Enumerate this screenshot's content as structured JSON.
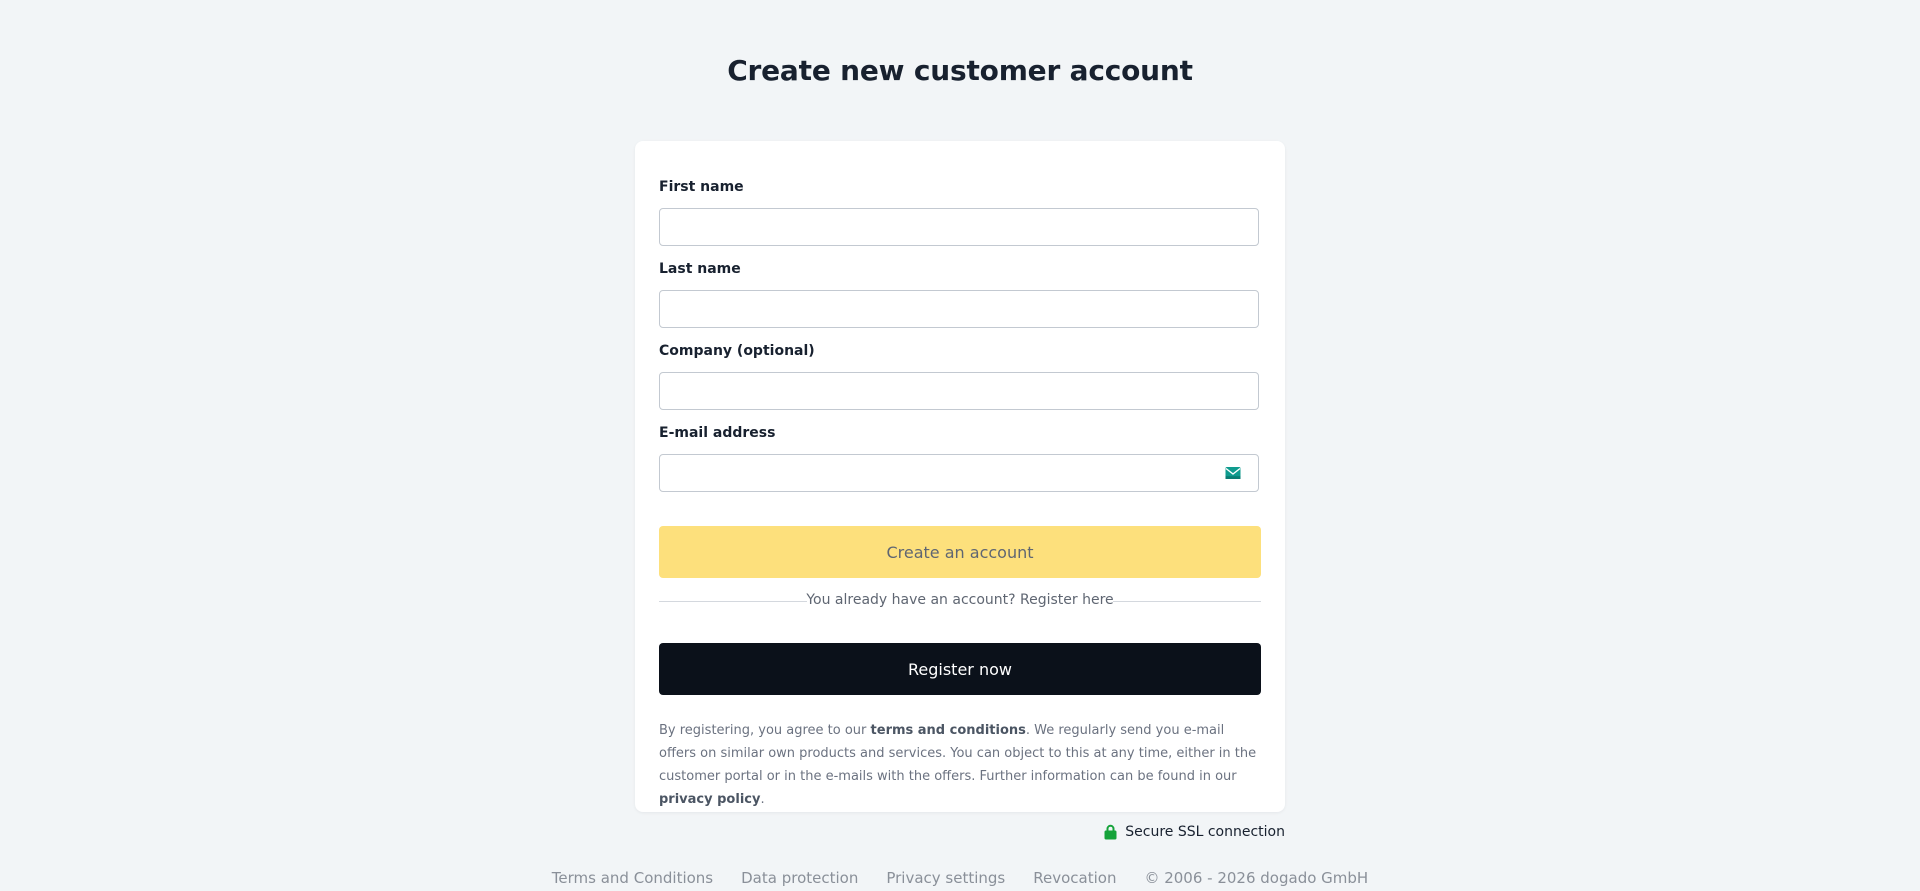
{
  "page": {
    "title": "Create new customer account"
  },
  "form": {
    "fields": [
      {
        "label": "First name",
        "value": "",
        "placeholder": ""
      },
      {
        "label": "Last name",
        "value": "",
        "placeholder": ""
      },
      {
        "label": "Company (optional)",
        "value": "",
        "placeholder": ""
      },
      {
        "label": "E-mail address",
        "value": "",
        "placeholder": "",
        "icon": "email-icon"
      }
    ],
    "create_button": "Create an account",
    "divider_text": "You already have an account? Register here",
    "register_button": "Register now",
    "legal": {
      "part1": "By registering, you agree to our ",
      "terms_link": "terms and conditions",
      "part2": ". We regularly send you e-mail offers on similar own products and services. You can object to this at any time, either in the customer portal or in the e-mails with the offers. Further information can be found in our ",
      "privacy_link": "privacy policy",
      "part3": "."
    }
  },
  "security": {
    "icon": "lock-icon",
    "label": "Secure SSL connection"
  },
  "footer": {
    "links": [
      "Terms and Conditions",
      "Data protection",
      "Privacy settings",
      "Revocation"
    ],
    "copyright": "© 2006 - 2026 dogado GmbH"
  },
  "colors": {
    "background": "#f2f5f7",
    "primary_button": "#fde07c",
    "secondary_button": "#0b111a",
    "email_icon": "#0f9b8e",
    "lock_icon": "#15a33a"
  }
}
